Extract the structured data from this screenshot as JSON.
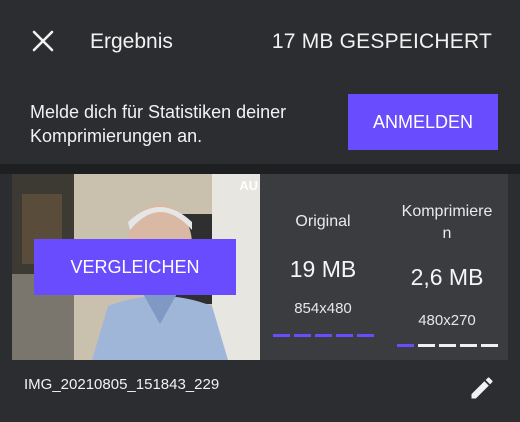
{
  "header": {
    "title": "Ergebnis",
    "saved_label": "17 MB GESPEICHERT",
    "close_icon": "close-icon"
  },
  "banner": {
    "text": "Melde dich für Statistiken deiner Komprimierungen an.",
    "login_label": "ANMELDEN"
  },
  "card": {
    "compare_label": "VERGLEICHEN",
    "thumbnail_corner_text": "AU",
    "original": {
      "label": "Original",
      "size": "19 MB",
      "resolution": "854x480"
    },
    "compressed": {
      "label_line1": "Komprimiere",
      "label_line2": "n",
      "size": "2,6 MB",
      "resolution": "480x270"
    }
  },
  "file": {
    "name": "IMG_20210805_151843_229",
    "edit_icon": "pencil-icon"
  },
  "colors": {
    "accent": "#6a4cff",
    "background": "#2b2d30",
    "card": "#3a3c40"
  }
}
